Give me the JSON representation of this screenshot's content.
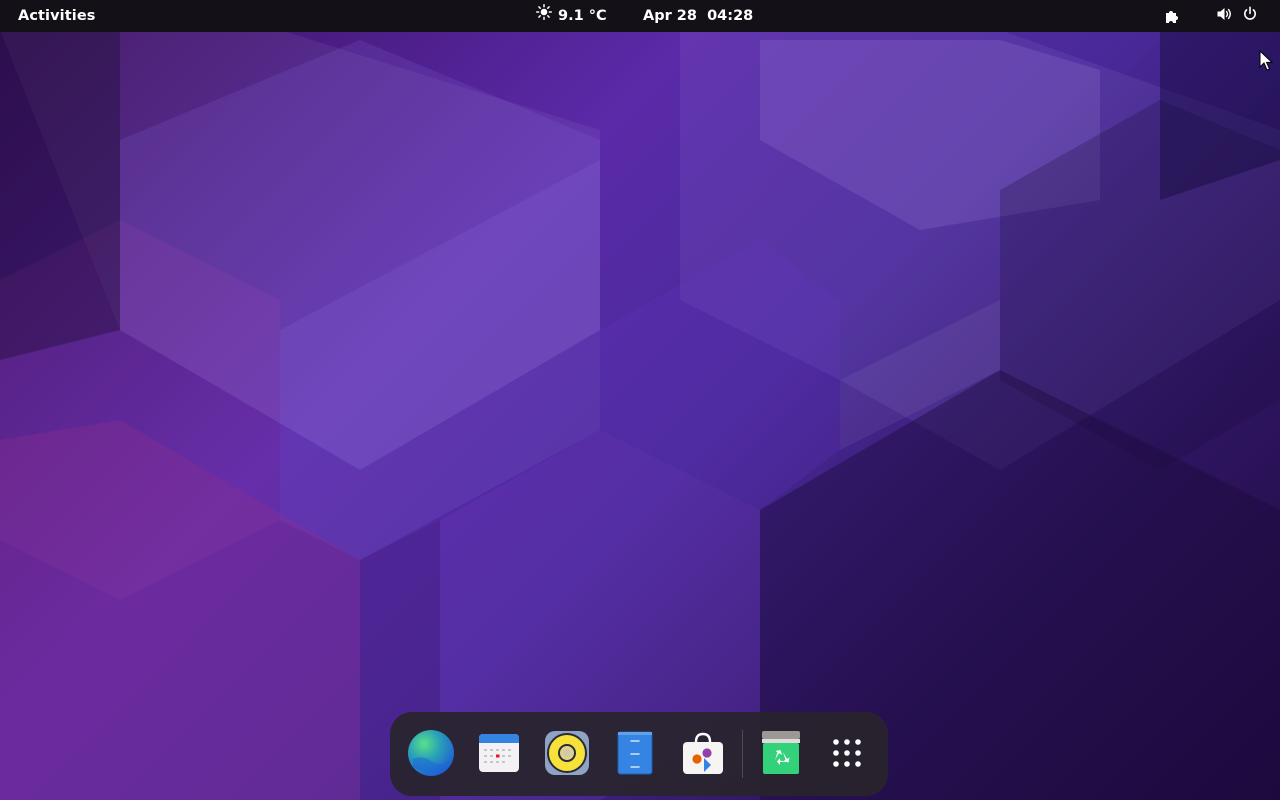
{
  "topbar": {
    "activities_label": "Activities",
    "weather": {
      "icon": "sun-icon",
      "text": "9.1 °C"
    },
    "clock": {
      "date": "Apr 28",
      "time": "04:28"
    },
    "indicators": [
      "puzzle-extension-icon",
      "volume-icon",
      "power-icon"
    ]
  },
  "dock": {
    "apps": [
      {
        "name": "web-browser",
        "icon": "globe-icon"
      },
      {
        "name": "calendar",
        "icon": "calendar-icon"
      },
      {
        "name": "music-player",
        "icon": "speaker-icon"
      },
      {
        "name": "files",
        "icon": "file-cabinet-icon"
      },
      {
        "name": "software",
        "icon": "software-store-icon"
      },
      {
        "name": "trash",
        "icon": "recycle-icon"
      },
      {
        "name": "show-applications",
        "icon": "app-grid-icon"
      }
    ]
  },
  "colors": {
    "topbar_bg": "#141018",
    "wallpaper_main": "#5a2aa8",
    "dock_bg": "#28242c"
  }
}
